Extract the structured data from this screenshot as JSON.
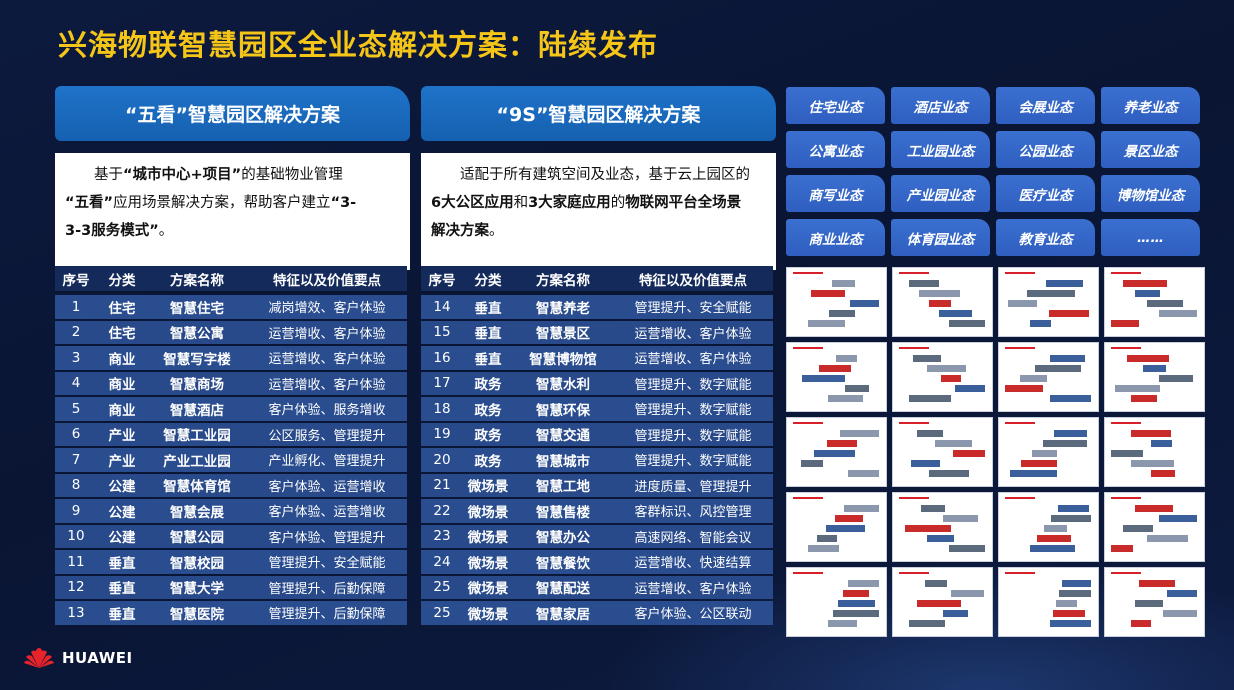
{
  "title": "兴海物联智慧园区全业态解决方案：陆续发布",
  "left": {
    "header": "“五看”智慧园区解决方案",
    "desc_lines": [
      {
        "parts": [
          {
            "t": "　　基于",
            "b": false
          },
          {
            "t": "“城市中心+项目”",
            "b": true
          },
          {
            "t": "的基础物业管理",
            "b": false
          }
        ]
      },
      {
        "parts": [
          {
            "t": "“五看”",
            "b": true
          },
          {
            "t": "应用场景解决方案，帮助客户建立",
            "b": false
          },
          {
            "t": "“3-",
            "b": true
          }
        ]
      },
      {
        "parts": [
          {
            "t": "3-3服务模式”",
            "b": true
          },
          {
            "t": "。",
            "b": false
          }
        ]
      }
    ],
    "columns": [
      "序号",
      "分类",
      "方案名称",
      "特征以及价值要点"
    ],
    "rows": [
      [
        "1",
        "住宅",
        "智慧住宅",
        "减岗增效、客户体验"
      ],
      [
        "2",
        "住宅",
        "智慧公寓",
        "运营增收、客户体验"
      ],
      [
        "3",
        "商业",
        "智慧写字楼",
        "运营增收、客户体验"
      ],
      [
        "4",
        "商业",
        "智慧商场",
        "运营增收、客户体验"
      ],
      [
        "5",
        "商业",
        "智慧酒店",
        "客户体验、服务增收"
      ],
      [
        "6",
        "产业",
        "智慧工业园",
        "公区服务、管理提升"
      ],
      [
        "7",
        "产业",
        "产业工业园",
        "产业孵化、管理提升"
      ],
      [
        "8",
        "公建",
        "智慧体育馆",
        "客户体验、运营增收"
      ],
      [
        "9",
        "公建",
        "智慧会展",
        "客户体验、运营增收"
      ],
      [
        "10",
        "公建",
        "智慧公园",
        "客户体验、管理提升"
      ],
      [
        "11",
        "垂直",
        "智慧校园",
        "管理提升、安全赋能"
      ],
      [
        "12",
        "垂直",
        "智慧大学",
        "管理提升、后勤保障"
      ],
      [
        "13",
        "垂直",
        "智慧医院",
        "管理提升、后勤保障"
      ]
    ]
  },
  "middle": {
    "header": "“9S”智慧园区解决方案",
    "desc_lines": [
      {
        "parts": [
          {
            "t": "　　适配于所有建筑空间及业态，基于云上园区的",
            "b": false
          }
        ]
      },
      {
        "parts": [
          {
            "t": "6大公区应用",
            "b": true
          },
          {
            "t": "和",
            "b": false
          },
          {
            "t": "3大家庭应用",
            "b": true
          },
          {
            "t": "的",
            "b": false
          },
          {
            "t": "物联网平台全场景",
            "b": true
          }
        ]
      },
      {
        "parts": [
          {
            "t": "解决方案",
            "b": true
          },
          {
            "t": "。",
            "b": false
          }
        ]
      }
    ],
    "columns": [
      "序号",
      "分类",
      "方案名称",
      "特征以及价值要点"
    ],
    "rows": [
      [
        "14",
        "垂直",
        "智慧养老",
        "管理提升、安全赋能"
      ],
      [
        "15",
        "垂直",
        "智慧景区",
        "运营增收、客户体验"
      ],
      [
        "16",
        "垂直",
        "智慧博物馆",
        "运营增收、客户体验"
      ],
      [
        "17",
        "政务",
        "智慧水利",
        "管理提升、数字赋能"
      ],
      [
        "18",
        "政务",
        "智慧环保",
        "管理提升、数字赋能"
      ],
      [
        "19",
        "政务",
        "智慧交通",
        "管理提升、数字赋能"
      ],
      [
        "20",
        "政务",
        "智慧城市",
        "管理提升、数字赋能"
      ],
      [
        "21",
        "微场景",
        "智慧工地",
        "进度质量、管理提升"
      ],
      [
        "22",
        "微场景",
        "智慧售楼",
        "客群标识、风控管理"
      ],
      [
        "23",
        "微场景",
        "智慧办公",
        "高速网络、智能会议"
      ],
      [
        "24",
        "微场景",
        "智慧餐饮",
        "运营增收、快速结算"
      ],
      [
        "25",
        "微场景",
        "智慧配送",
        "运营增收、客户体验"
      ],
      [
        "25",
        "微场景",
        "智慧家居",
        "客户体验、公区联动"
      ]
    ]
  },
  "business_tags": [
    "住宅业态",
    "酒店业态",
    "会展业态",
    "养老业态",
    "公寓业态",
    "工业园业态",
    "公园业态",
    "景区业态",
    "商写业态",
    "产业园业态",
    "医疗业态",
    "博物馆业态",
    "商业业态",
    "体育园业态",
    "教育业态",
    "……"
  ],
  "thumbnail_count": 20,
  "brand": "HUAWEI",
  "colors": {
    "title": "#f5c518",
    "header": "#1e73c9",
    "row": "#2a4d8f",
    "tag": "#3a6fd0"
  }
}
